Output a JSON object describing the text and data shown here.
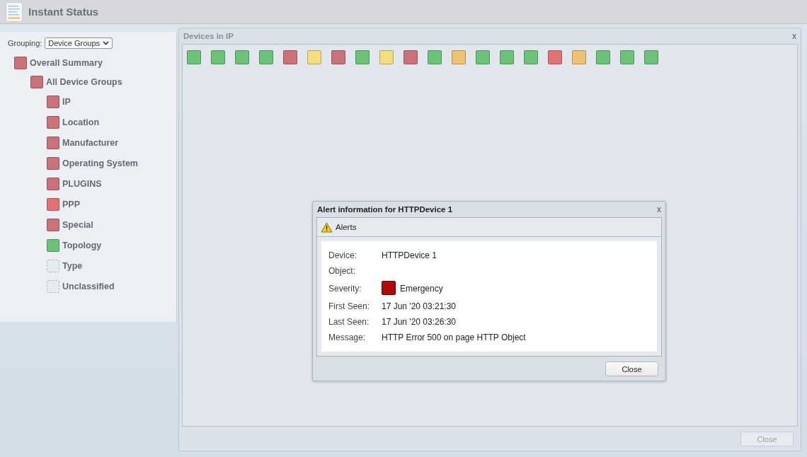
{
  "header": {
    "title": "Instant Status"
  },
  "sidebar": {
    "grouping_label": "Grouping:",
    "grouping_value": "Device Groups",
    "tree": [
      {
        "label": "Overall Summary",
        "color": "#c9727a",
        "children": [
          {
            "label": "All Device Groups",
            "color": "#c9727a",
            "children": [
              {
                "label": "IP",
                "color": "#c9727a"
              },
              {
                "label": "Location",
                "color": "#c9727a"
              },
              {
                "label": "Manufacturer",
                "color": "#c9727a"
              },
              {
                "label": "Operating System",
                "color": "#c9727a"
              },
              {
                "label": "PLUGINS",
                "color": "#c9727a"
              },
              {
                "label": "PPP",
                "color": "#e07474"
              },
              {
                "label": "Special",
                "color": "#c9727a"
              },
              {
                "label": "Topology",
                "color": "#6cc278"
              },
              {
                "label": "Type"
              },
              {
                "label": "Unclassified"
              }
            ]
          }
        ]
      }
    ]
  },
  "devices_window": {
    "title": "Devices in IP",
    "close_icon": "x",
    "close_button": {
      "label": "Close",
      "disabled": true
    },
    "devices": [
      {
        "color": "#6cc278"
      },
      {
        "color": "#6cc278"
      },
      {
        "color": "#6cc278"
      },
      {
        "color": "#6cc278"
      },
      {
        "color": "#c9727a"
      },
      {
        "color": "#f1de81"
      },
      {
        "color": "#c9727a"
      },
      {
        "color": "#6cc278"
      },
      {
        "color": "#f1de81"
      },
      {
        "color": "#c9727a"
      },
      {
        "color": "#6cc278"
      },
      {
        "color": "#eec274"
      },
      {
        "color": "#6cc278"
      },
      {
        "color": "#6cc278"
      },
      {
        "color": "#6cc278"
      },
      {
        "color": "#e07474"
      },
      {
        "color": "#eec274"
      },
      {
        "color": "#6cc278"
      },
      {
        "color": "#6cc278"
      },
      {
        "color": "#6cc278"
      }
    ]
  },
  "alert_dialog": {
    "title": "Alert information for HTTPDevice 1",
    "close_icon": "x",
    "section": "Alerts",
    "fields": [
      {
        "label": "Device:",
        "value": "HTTPDevice 1"
      },
      {
        "label": "Object:"
      },
      {
        "label": "Severity:",
        "value": "Emergency",
        "color": "#b00a0a"
      },
      {
        "label": "First Seen:",
        "value": "17 Jun '20 03:21:30"
      },
      {
        "label": "Last Seen:",
        "value": "17 Jun '20 03:26:30"
      },
      {
        "label": "Message:",
        "value": "HTTP Error 500 on page HTTP Object"
      }
    ],
    "close_button": {
      "label": "Close",
      "disabled": false
    }
  }
}
